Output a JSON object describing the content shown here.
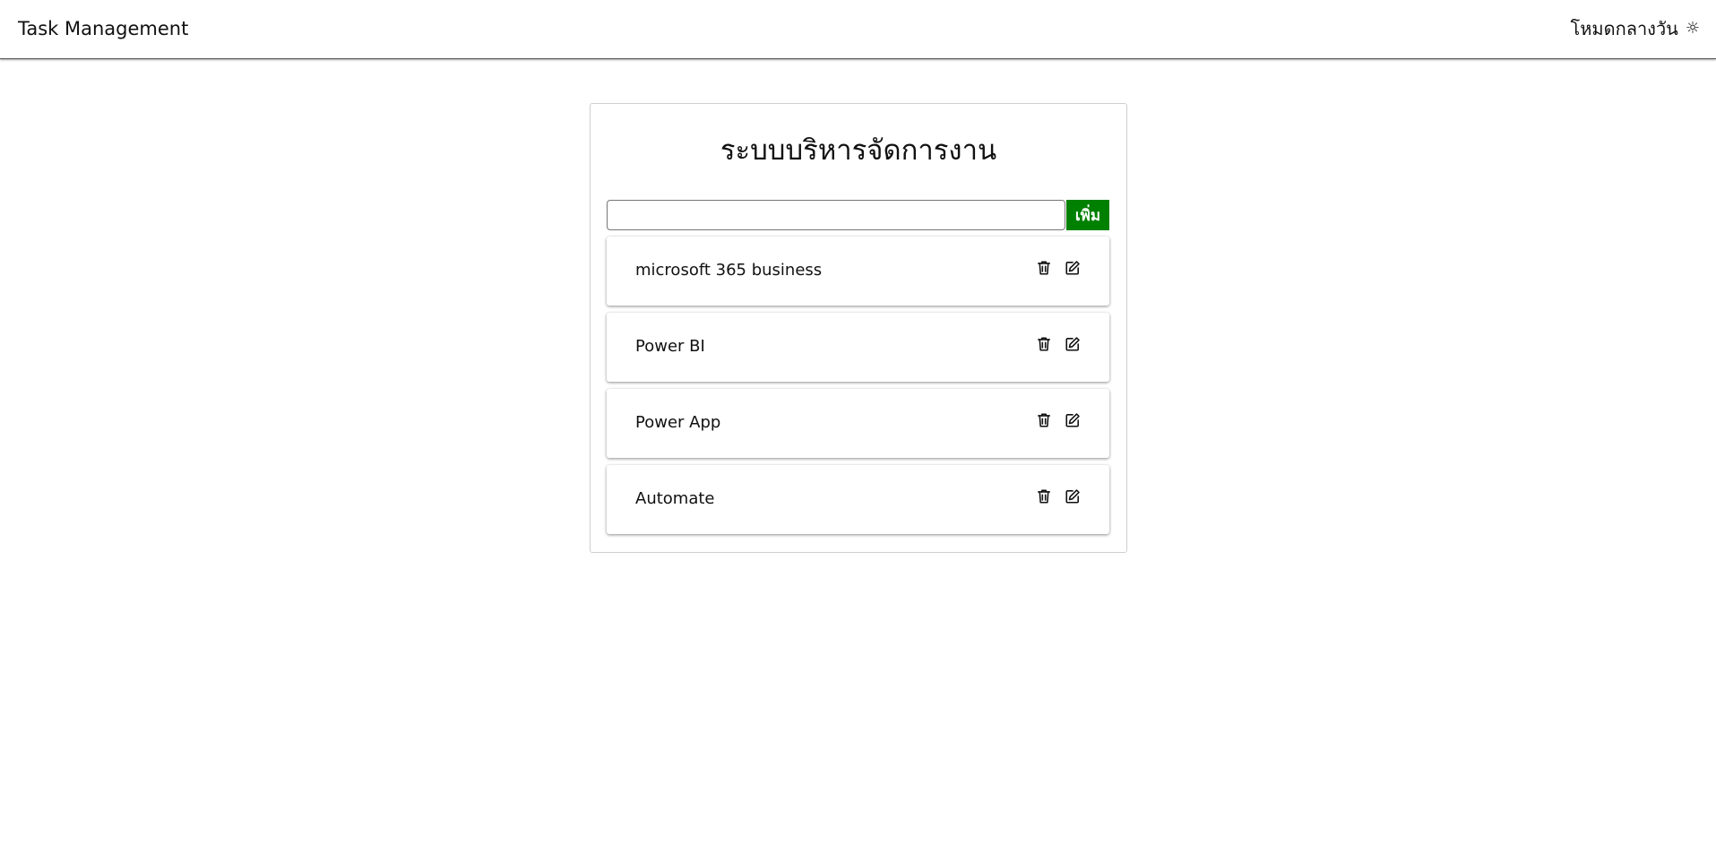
{
  "navbar": {
    "brand": "Task Management",
    "mode_label": "โหมดกลางวัน",
    "mode_icon": "sun-icon"
  },
  "card": {
    "title": "ระบบบริหารจัดการงาน",
    "input": {
      "value": "",
      "placeholder": ""
    },
    "add_label": "เพิ่ม",
    "add_color": "#008000"
  },
  "tasks": [
    {
      "text": "microsoft 365 business"
    },
    {
      "text": "Power BI"
    },
    {
      "text": "Power App"
    },
    {
      "text": "Automate"
    }
  ],
  "icons": {
    "delete": "trash-icon",
    "edit": "edit-icon"
  }
}
